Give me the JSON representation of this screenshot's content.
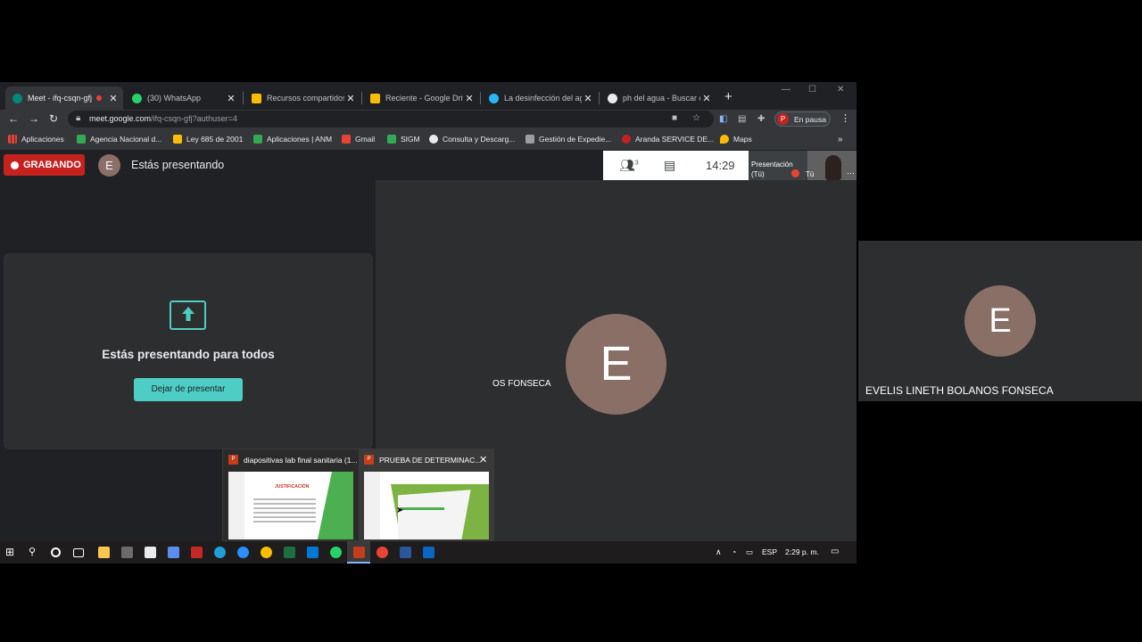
{
  "browser": {
    "tabs": [
      {
        "label": "Meet - ifq-csqn-gfj",
        "color": "#00897b",
        "active": true
      },
      {
        "label": "(30) WhatsApp",
        "color": "#25d366"
      },
      {
        "label": "Recursos compartidos",
        "color": "#fbbc04"
      },
      {
        "label": "Reciente - Google Drive",
        "color": "#fbbc04"
      },
      {
        "label": "La desinfección del agu",
        "color": "#29b6f6"
      },
      {
        "label": "ph del agua - Buscar co",
        "color": "#e8eaed"
      }
    ],
    "new_tab": "+",
    "url_host": "meet.google.com",
    "url_path": "/ifq-csqn-gfj?authuser=4",
    "profile_initial": "P",
    "profile_status": "En pausa",
    "bookmarks": [
      "Aplicaciones",
      "Agencia Nacional d...",
      "Ley 685 de 2001",
      "Aplicaciones | ANM",
      "Gmail",
      "SIGM",
      "Consulta y Descarg...",
      "Gestión de Expedie...",
      "Aranda SERVICE DE...",
      "Maps"
    ]
  },
  "meet": {
    "recording_label": "GRABANDO",
    "presenter_initial": "E",
    "presenting_label": "Estás presentando",
    "participants_count": "3",
    "clock": "14:29",
    "self_tile_label": "Presentación\n(Tú)",
    "self_tile_you": "Tú",
    "present_message": "Estás presentando para todos",
    "stop_button": "Dejar de presentar",
    "main_avatar_initial": "E",
    "main_name_partial": "OS FONSECA"
  },
  "thumbnails": [
    {
      "title": "diapositivas lab final sanitaria (1...",
      "slide_title": "JUSTIFICACIÓN"
    },
    {
      "title": "PRUEBA DE DETERMINAC...",
      "slide_title": ""
    }
  ],
  "taskbar": {
    "language": "ESP",
    "time": "2:29 p. m."
  },
  "side_participant": {
    "initial": "E",
    "name": "EVELIS LINETH BOLANOS FONSECA"
  }
}
